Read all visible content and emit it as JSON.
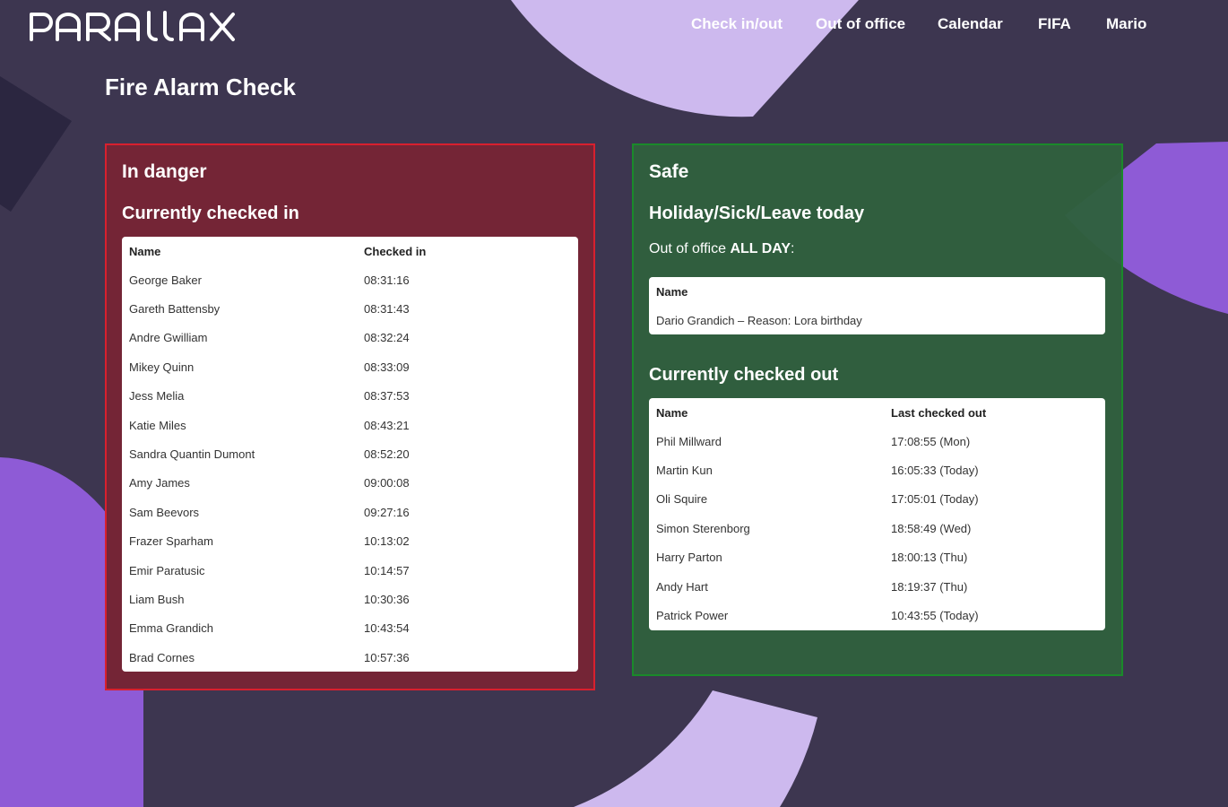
{
  "brand": {
    "logo_text": "PARALLAX"
  },
  "nav": {
    "items": [
      {
        "label": "Check in/out"
      },
      {
        "label": "Out of office"
      },
      {
        "label": "Calendar"
      },
      {
        "label": "FIFA"
      },
      {
        "label": "Mario"
      }
    ]
  },
  "page": {
    "title": "Fire Alarm Check"
  },
  "danger": {
    "heading": "In danger",
    "checked_in": {
      "heading": "Currently checked in",
      "columns": [
        "Name",
        "Checked in"
      ],
      "rows": [
        {
          "name": "George Baker",
          "time": "08:31:16"
        },
        {
          "name": "Gareth Battensby",
          "time": "08:31:43"
        },
        {
          "name": "Andre Gwilliam",
          "time": "08:32:24"
        },
        {
          "name": "Mikey Quinn",
          "time": "08:33:09"
        },
        {
          "name": "Jess Melia",
          "time": "08:37:53"
        },
        {
          "name": "Katie Miles",
          "time": "08:43:21"
        },
        {
          "name": "Sandra Quantin Dumont",
          "time": "08:52:20"
        },
        {
          "name": "Amy James",
          "time": "09:00:08"
        },
        {
          "name": "Sam Beevors",
          "time": "09:27:16"
        },
        {
          "name": "Frazer Sparham",
          "time": "10:13:02"
        },
        {
          "name": "Emir Paratusic",
          "time": "10:14:57"
        },
        {
          "name": "Liam Bush",
          "time": "10:30:36"
        },
        {
          "name": "Emma Grandich",
          "time": "10:43:54"
        },
        {
          "name": "Brad Cornes",
          "time": "10:57:36"
        }
      ]
    }
  },
  "safe": {
    "heading": "Safe",
    "leave": {
      "heading": "Holiday/Sick/Leave today",
      "ooo_prefix": "Out of office",
      "ooo_emphasis": "ALL DAY",
      "ooo_suffix": ":",
      "columns": [
        "Name"
      ],
      "rows": [
        {
          "entry": "Dario Grandich – Reason: Lora birthday"
        }
      ]
    },
    "checked_out": {
      "heading": "Currently checked out",
      "columns": [
        "Name",
        "Last checked out"
      ],
      "rows": [
        {
          "name": "Phil Millward",
          "time": "17:08:55 (Mon)"
        },
        {
          "name": "Martin Kun",
          "time": "16:05:33 (Today)"
        },
        {
          "name": "Oli Squire",
          "time": "17:05:01 (Today)"
        },
        {
          "name": "Simon Sterenborg",
          "time": "18:58:49 (Wed)"
        },
        {
          "name": "Harry Parton",
          "time": "18:00:13 (Thu)"
        },
        {
          "name": "Andy Hart",
          "time": "18:19:37 (Thu)"
        },
        {
          "name": "Patrick Power",
          "time": "10:43:55 (Today)"
        }
      ]
    }
  },
  "colors": {
    "background": "#3d3650",
    "danger_fill": "#742536",
    "danger_border": "#d8202e",
    "safe_fill": "#30603e",
    "safe_border": "#1a8a2a",
    "lilac": "#cdb9ee",
    "violet": "#8e5bd6"
  }
}
